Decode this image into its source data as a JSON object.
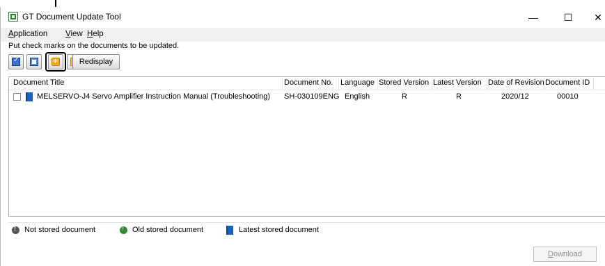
{
  "window": {
    "title": "GT Document Update Tool",
    "minimize": "—",
    "maximize": "☐",
    "close": "✕"
  },
  "menu": [
    {
      "acc": "A",
      "rest": "pplication"
    },
    {
      "acc": "V",
      "rest": "iew"
    },
    {
      "acc": "H",
      "rest": "elp"
    }
  ],
  "instruction": "Put check marks on the documents to be updated.",
  "toolbar": {
    "buttons": [
      "check-all-icon",
      "uncheck-all-icon",
      "add-document-icon",
      "open-folder-icon"
    ],
    "redisplay_label": "Redisplay"
  },
  "table": {
    "headers": [
      "Document Title",
      "Document No.",
      "Language",
      "Stored Version",
      "Latest Version",
      "Date of Revision",
      "Document ID"
    ],
    "rows": [
      {
        "title": "MELSERVO-J4 Servo Amplifier Instruction Manual (Troubleshooting)",
        "doc_no": "SH-030109ENG",
        "language": "English",
        "stored_version": "R",
        "latest_version": "R",
        "date_of_revision": "2020/12",
        "document_id": "00010",
        "checked": false
      }
    ]
  },
  "legend": {
    "not_stored": "Not stored document",
    "old_stored": "Old stored document",
    "latest_stored": "Latest stored document"
  },
  "download": {
    "acc": "D",
    "rest": "ownload"
  },
  "colors": {
    "accent_blue": "#1e5fc2",
    "green": "#2e8b2e",
    "menubar_bg": "#f0f0f0"
  }
}
